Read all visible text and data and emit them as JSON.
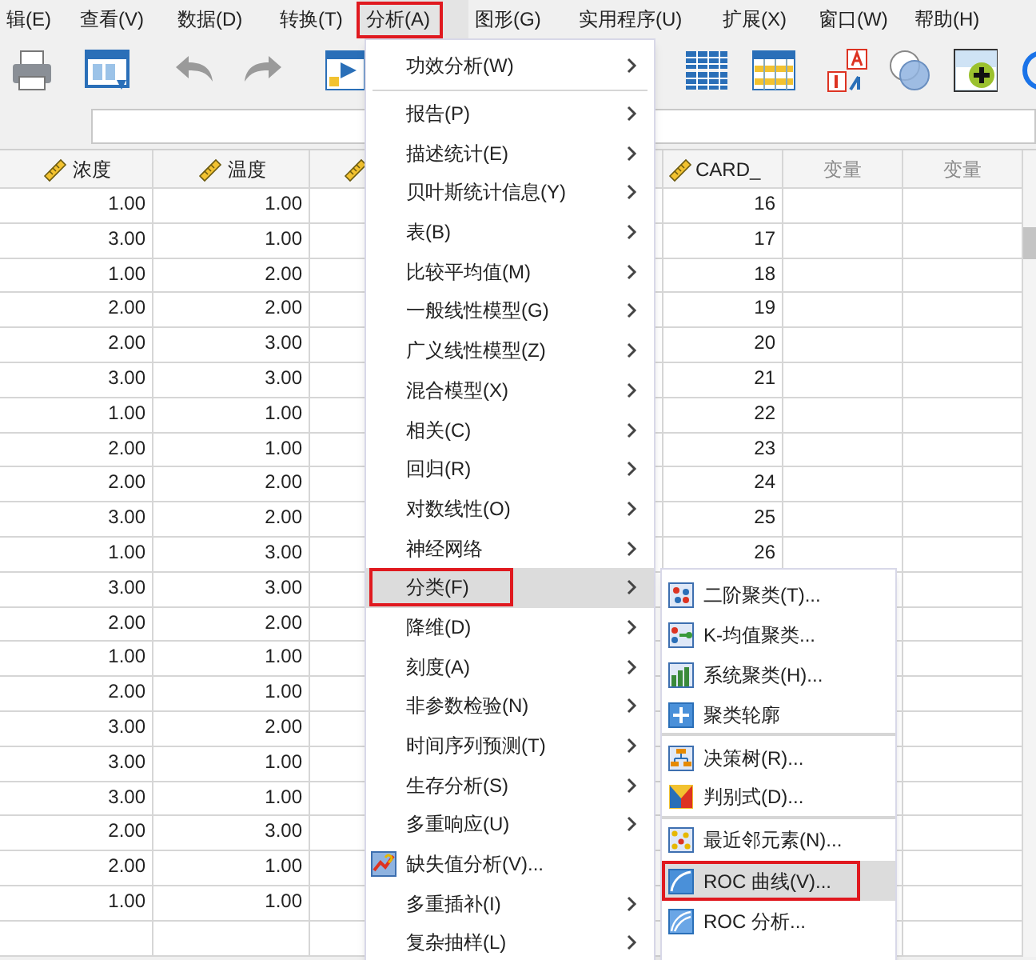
{
  "menubar": [
    {
      "label": "辑(E)",
      "selected": false,
      "marked": false
    },
    {
      "label": "查看(V)",
      "selected": false,
      "marked": false
    },
    {
      "label": "数据(D)",
      "selected": false,
      "marked": false
    },
    {
      "label": "转换(T)",
      "selected": false,
      "marked": false
    },
    {
      "label": "分析(A)",
      "selected": true,
      "marked": true
    },
    {
      "label": "图形(G)",
      "selected": false,
      "marked": false
    },
    {
      "label": "实用程序(U)",
      "selected": false,
      "marked": false
    },
    {
      "label": "扩展(X)",
      "selected": false,
      "marked": false
    },
    {
      "label": "窗口(W)",
      "selected": false,
      "marked": false
    },
    {
      "label": "帮助(H)",
      "selected": false,
      "marked": false
    }
  ],
  "grid": {
    "columns": [
      {
        "label": "浓度",
        "kind": "scale"
      },
      {
        "label": "温度",
        "kind": "scale"
      },
      {
        "kind": "scale"
      },
      {
        "label": "CARD_",
        "kind": "scale"
      },
      {
        "label": "变量",
        "kind": "empty"
      },
      {
        "label": "变量",
        "kind": "empty"
      }
    ],
    "rows": [
      [
        "1.00",
        "1.00",
        "16"
      ],
      [
        "3.00",
        "1.00",
        "17"
      ],
      [
        "1.00",
        "2.00",
        "18"
      ],
      [
        "2.00",
        "2.00",
        "19"
      ],
      [
        "2.00",
        "3.00",
        "20"
      ],
      [
        "3.00",
        "3.00",
        "21"
      ],
      [
        "1.00",
        "1.00",
        "22"
      ],
      [
        "2.00",
        "1.00",
        "23"
      ],
      [
        "2.00",
        "2.00",
        "24"
      ],
      [
        "3.00",
        "2.00",
        "25"
      ],
      [
        "1.00",
        "3.00",
        "26"
      ],
      [
        "3.00",
        "3.00"
      ],
      [
        "2.00",
        "2.00"
      ],
      [
        "1.00",
        "1.00"
      ],
      [
        "2.00",
        "1.00"
      ],
      [
        "3.00",
        "2.00"
      ],
      [
        "3.00",
        "1.00"
      ],
      [
        "3.00",
        "1.00"
      ],
      [
        "2.00",
        "3.00"
      ],
      [
        "2.00",
        "1.00"
      ],
      [
        "1.00",
        "1.00"
      ]
    ]
  },
  "analyze_menu": [
    {
      "label": "功效分析(W)",
      "submenu": true,
      "selected": false,
      "marked": false,
      "separator_after": true
    },
    {
      "label": "报告(P)",
      "submenu": true,
      "selected": false,
      "marked": false,
      "separator_after": false
    },
    {
      "label": "描述统计(E)",
      "submenu": true,
      "selected": false,
      "marked": false,
      "separator_after": false
    },
    {
      "label": "贝叶斯统计信息(Y)",
      "submenu": true,
      "selected": false,
      "marked": false,
      "separator_after": false
    },
    {
      "label": "表(B)",
      "submenu": true,
      "selected": false,
      "marked": false,
      "separator_after": false
    },
    {
      "label": "比较平均值(M)",
      "submenu": true,
      "selected": false,
      "marked": false,
      "separator_after": false
    },
    {
      "label": "一般线性模型(G)",
      "submenu": true,
      "selected": false,
      "marked": false,
      "separator_after": false
    },
    {
      "label": "广义线性模型(Z)",
      "submenu": true,
      "selected": false,
      "marked": false,
      "separator_after": false
    },
    {
      "label": "混合模型(X)",
      "submenu": true,
      "selected": false,
      "marked": false,
      "separator_after": false
    },
    {
      "label": "相关(C)",
      "submenu": true,
      "selected": false,
      "marked": false,
      "separator_after": false
    },
    {
      "label": "回归(R)",
      "submenu": true,
      "selected": false,
      "marked": false,
      "separator_after": false
    },
    {
      "label": "对数线性(O)",
      "submenu": true,
      "selected": false,
      "marked": false,
      "separator_after": false
    },
    {
      "label": "神经网络",
      "submenu": true,
      "selected": false,
      "marked": false,
      "separator_after": false
    },
    {
      "label": "分类(F)",
      "submenu": true,
      "selected": true,
      "marked": true,
      "separator_after": false
    },
    {
      "label": "降维(D)",
      "submenu": true,
      "selected": false,
      "marked": false,
      "separator_after": false
    },
    {
      "label": "刻度(A)",
      "submenu": true,
      "selected": false,
      "marked": false,
      "separator_after": false
    },
    {
      "label": "非参数检验(N)",
      "submenu": true,
      "selected": false,
      "marked": false,
      "separator_after": false
    },
    {
      "label": "时间序列预测(T)",
      "submenu": true,
      "selected": false,
      "marked": false,
      "separator_after": false
    },
    {
      "label": "生存分析(S)",
      "submenu": true,
      "selected": false,
      "marked": false,
      "separator_after": false
    },
    {
      "label": "多重响应(U)",
      "submenu": true,
      "selected": false,
      "marked": false,
      "separator_after": false
    },
    {
      "label": "缺失值分析(V)...",
      "submenu": false,
      "selected": false,
      "marked": false,
      "separator_after": false
    },
    {
      "label": "多重插补(I)",
      "submenu": true,
      "selected": false,
      "marked": false,
      "separator_after": false
    },
    {
      "label": "复杂抽样(L)",
      "submenu": true,
      "selected": false,
      "marked": false,
      "separator_after": false
    }
  ],
  "classify_menu": [
    {
      "label": "二阶聚类(T)...",
      "selected": false,
      "marked": false,
      "separator_after": false
    },
    {
      "label": "K-均值聚类...",
      "selected": false,
      "marked": false,
      "separator_after": false
    },
    {
      "label": "系统聚类(H)...",
      "selected": false,
      "marked": false,
      "separator_after": false
    },
    {
      "label": "聚类轮廓",
      "selected": false,
      "marked": false,
      "separator_after": true
    },
    {
      "label": "决策树(R)...",
      "selected": false,
      "marked": false,
      "separator_after": false
    },
    {
      "label": "判别式(D)...",
      "selected": false,
      "marked": false,
      "separator_after": true
    },
    {
      "label": "最近邻元素(N)...",
      "selected": false,
      "marked": false,
      "separator_after": false
    },
    {
      "label": "ROC 曲线(V)...",
      "selected": true,
      "marked": true,
      "separator_after": false
    },
    {
      "label": "ROC 分析...",
      "selected": false,
      "marked": false,
      "separator_after": false
    }
  ]
}
